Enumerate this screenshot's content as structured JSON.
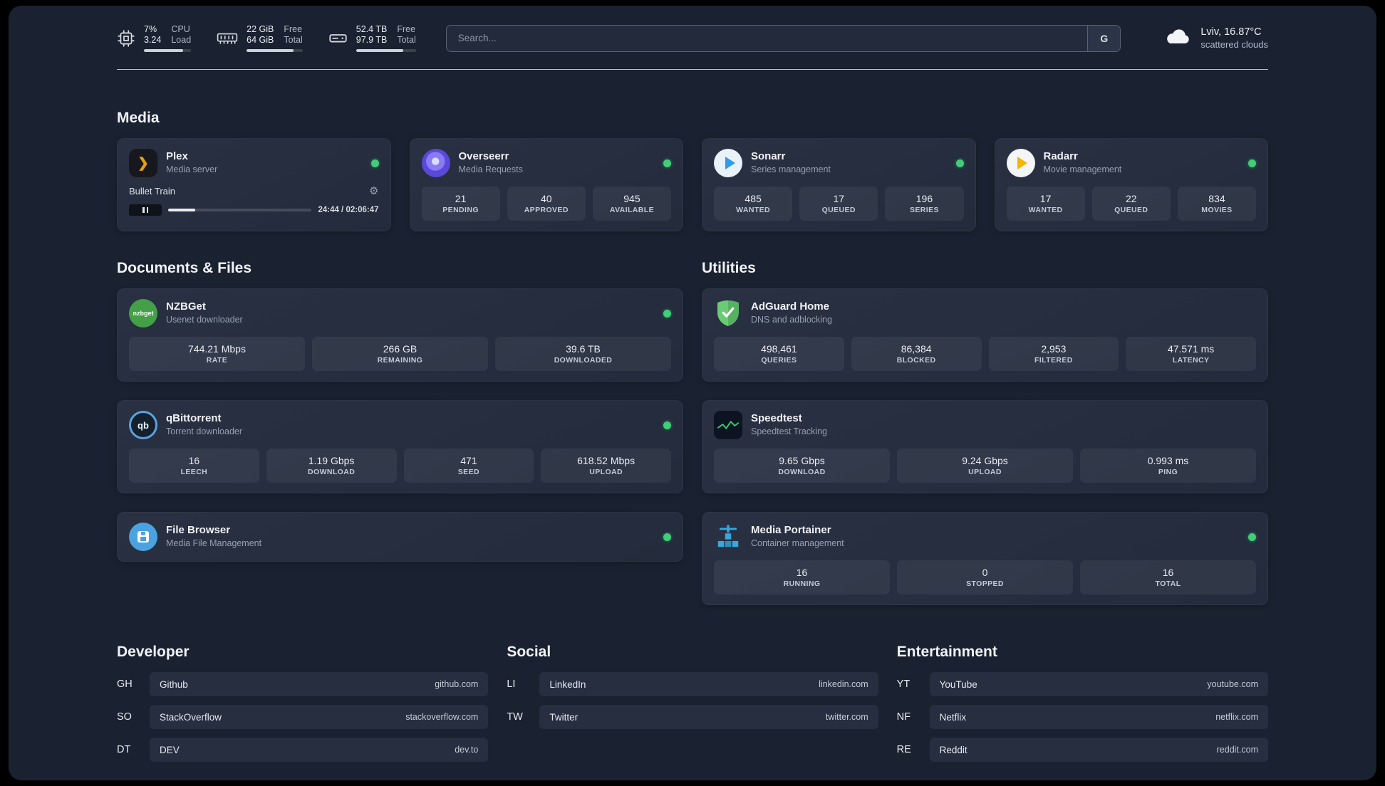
{
  "colors": {
    "page_background": "#1a2231",
    "card_background": "#262e3f",
    "status_online_green": "#3fcf77",
    "plex_orange": "#e5a00d",
    "divider": "#dadfe7"
  },
  "icons": {
    "gear": "⚙",
    "plex_chevron": "❯"
  },
  "topbar": {
    "cpu": {
      "value1": "7%",
      "value2": "3.24",
      "label1": "CPU",
      "label2": "Load",
      "bar_percent": 83
    },
    "ram": {
      "value1": "22 GiB",
      "value2": "64 GiB",
      "label1": "Free",
      "label2": "Total",
      "bar_percent": 84
    },
    "disk": {
      "value1": "52.4 TB",
      "value2": "97.9 TB",
      "label1": "Free",
      "label2": "Total",
      "bar_percent": 79
    },
    "search": {
      "placeholder": "Search...",
      "engine_label": "G"
    },
    "weather": {
      "location": "Lviv, 16.87°C",
      "condition": "scattered clouds"
    }
  },
  "sections": {
    "media": {
      "title": "Media"
    },
    "documents": {
      "title": "Documents & Files"
    },
    "utilities": {
      "title": "Utilities"
    }
  },
  "apps": {
    "plex": {
      "name": "Plex",
      "subtitle": "Media server",
      "online": true,
      "now_playing": "Bullet Train",
      "time": "24:44 / 02:06:47",
      "progress_percent": 19
    },
    "overseerr": {
      "name": "Overseerr",
      "subtitle": "Media Requests",
      "online": true,
      "stats": [
        {
          "value": "21",
          "label": "PENDING"
        },
        {
          "value": "40",
          "label": "APPROVED"
        },
        {
          "value": "945",
          "label": "AVAILABLE"
        }
      ]
    },
    "sonarr": {
      "name": "Sonarr",
      "subtitle": "Series management",
      "online": true,
      "stats": [
        {
          "value": "485",
          "label": "WANTED"
        },
        {
          "value": "17",
          "label": "QUEUED"
        },
        {
          "value": "196",
          "label": "SERIES"
        }
      ]
    },
    "radarr": {
      "name": "Radarr",
      "subtitle": "Movie management",
      "online": true,
      "stats": [
        {
          "value": "17",
          "label": "WANTED"
        },
        {
          "value": "22",
          "label": "QUEUED"
        },
        {
          "value": "834",
          "label": "MOVIES"
        }
      ]
    },
    "nzbget": {
      "name": "NZBGet",
      "subtitle": "Usenet downloader",
      "online": true,
      "icon_text": "nzbget",
      "stats": [
        {
          "value": "744.21 Mbps",
          "label": "RATE"
        },
        {
          "value": "266 GB",
          "label": "REMAINING"
        },
        {
          "value": "39.6 TB",
          "label": "DOWNLOADED"
        }
      ]
    },
    "qbittorrent": {
      "name": "qBittorrent",
      "subtitle": "Torrent downloader",
      "online": true,
      "icon_text": "qb",
      "stats": [
        {
          "value": "16",
          "label": "LEECH"
        },
        {
          "value": "1.19 Gbps",
          "label": "DOWNLOAD"
        },
        {
          "value": "471",
          "label": "SEED"
        },
        {
          "value": "618.52 Mbps",
          "label": "UPLOAD"
        }
      ]
    },
    "filebrowser": {
      "name": "File Browser",
      "subtitle": "Media File Management",
      "online": true
    },
    "adguard": {
      "name": "AdGuard Home",
      "subtitle": "DNS and adblocking",
      "stats": [
        {
          "value": "498,461",
          "label": "QUERIES"
        },
        {
          "value": "86,384",
          "label": "BLOCKED"
        },
        {
          "value": "2,953",
          "label": "FILTERED"
        },
        {
          "value": "47.571 ms",
          "label": "LATENCY"
        }
      ]
    },
    "speedtest": {
      "name": "Speedtest",
      "subtitle": "Speedtest Tracking",
      "stats": [
        {
          "value": "9.65 Gbps",
          "label": "DOWNLOAD"
        },
        {
          "value": "9.24 Gbps",
          "label": "UPLOAD"
        },
        {
          "value": "0.993 ms",
          "label": "PING"
        }
      ]
    },
    "portainer": {
      "name": "Media Portainer",
      "subtitle": "Container management",
      "online": true,
      "stats": [
        {
          "value": "16",
          "label": "RUNNING"
        },
        {
          "value": "0",
          "label": "STOPPED"
        },
        {
          "value": "16",
          "label": "TOTAL"
        }
      ]
    }
  },
  "link_sections": {
    "developer": {
      "title": "Developer",
      "items": [
        {
          "abbr": "GH",
          "name": "Github",
          "domain": "github.com"
        },
        {
          "abbr": "SO",
          "name": "StackOverflow",
          "domain": "stackoverflow.com"
        },
        {
          "abbr": "DT",
          "name": "DEV",
          "domain": "dev.to"
        }
      ]
    },
    "social": {
      "title": "Social",
      "items": [
        {
          "abbr": "LI",
          "name": "LinkedIn",
          "domain": "linkedin.com"
        },
        {
          "abbr": "TW",
          "name": "Twitter",
          "domain": "twitter.com"
        }
      ]
    },
    "entertainment": {
      "title": "Entertainment",
      "items": [
        {
          "abbr": "YT",
          "name": "YouTube",
          "domain": "youtube.com"
        },
        {
          "abbr": "NF",
          "name": "Netflix",
          "domain": "netflix.com"
        },
        {
          "abbr": "RE",
          "name": "Reddit",
          "domain": "reddit.com"
        }
      ]
    }
  }
}
